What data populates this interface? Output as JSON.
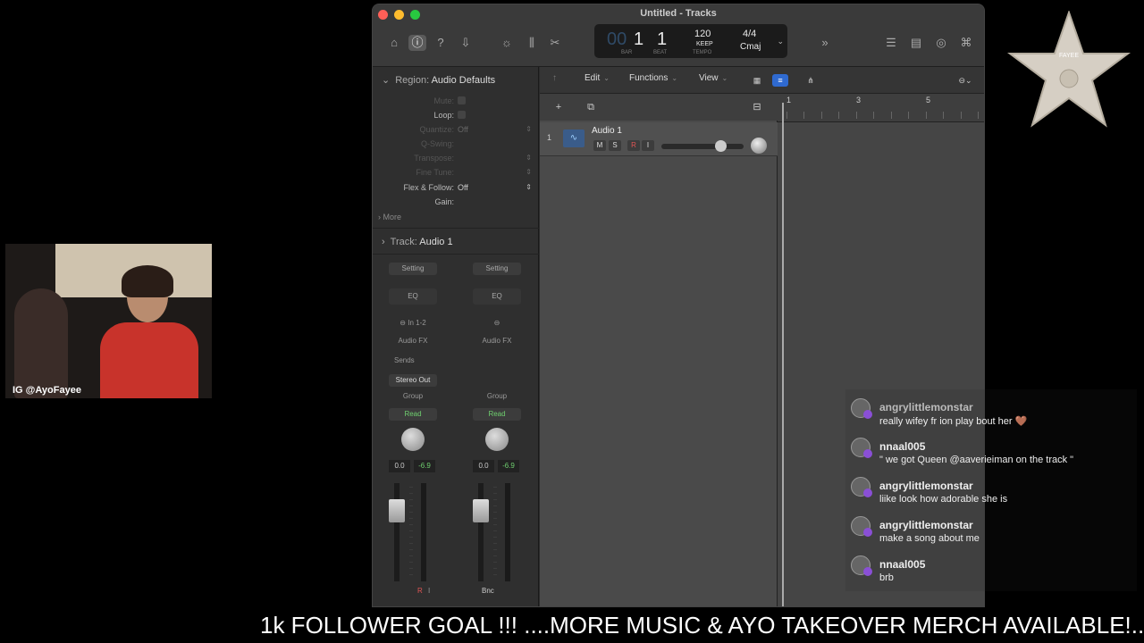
{
  "window": {
    "title": "Untitled - Tracks"
  },
  "lcd": {
    "bar": "1",
    "beat": "1",
    "bar_label": "BAR",
    "beat_label": "BEAT",
    "tempo": "120",
    "tempo_mode": "KEEP",
    "tempo_label": "TEMPO",
    "time_signature": "4/4",
    "key": "Cmaj"
  },
  "inspector": {
    "region_prefix": "Region:",
    "region_name": "Audio Defaults",
    "params": [
      {
        "label": "Mute:",
        "value": ""
      },
      {
        "label": "Loop:",
        "value": ""
      },
      {
        "label": "Quantize:",
        "value": "Off"
      },
      {
        "label": "Q-Swing:",
        "value": ""
      },
      {
        "label": "Transpose:",
        "value": ""
      },
      {
        "label": "Fine Tune:",
        "value": ""
      },
      {
        "label": "Flex & Follow:",
        "value": "Off"
      },
      {
        "label": "Gain:",
        "value": ""
      }
    ],
    "more_label": "More",
    "track_prefix": "Track:",
    "track_name": "Audio 1"
  },
  "strips": [
    {
      "setting": "Setting",
      "eq": "EQ",
      "input": "In 1-2",
      "audio_fx": "Audio FX",
      "sends": "Sends",
      "output": "Stereo Out",
      "group": "Group",
      "automation": "Read",
      "volume": "0.0",
      "peak": "-6.9",
      "rec": "R",
      "inp": "I",
      "bottom": ""
    },
    {
      "setting": "Setting",
      "eq": "EQ",
      "input": "",
      "audio_fx": "Audio FX",
      "sends": "",
      "output": "",
      "group": "Group",
      "automation": "Read",
      "volume": "0.0",
      "peak": "-6.9",
      "rec": "",
      "inp": "",
      "bottom": "Bnc"
    }
  ],
  "tracks_area": {
    "menus": [
      "Edit",
      "Functions",
      "View"
    ],
    "track": {
      "number": "1",
      "name": "Audio 1",
      "mute": "M",
      "solo": "S",
      "record": "R",
      "input_monitor": "I"
    },
    "ruler": [
      "1",
      "3",
      "5"
    ]
  },
  "chat": [
    {
      "user": "angrylittlemonstar",
      "text": "really wifey fr ion play bout her 🤎"
    },
    {
      "user": "nnaal005",
      "text": "\" we got Queen @aaverieiman on the track \""
    },
    {
      "user": "angrylittlemonstar",
      "text": "liike look how adorable she is"
    },
    {
      "user": "angrylittlemonstar",
      "text": "make a song about me"
    },
    {
      "user": "nnaal005",
      "text": "brb"
    }
  ],
  "webcam": {
    "label": "IG @AyoFayee"
  },
  "star": {
    "label": "FAYEE"
  },
  "ticker": {
    "text": "1k FOLLOWER GOAL !!! ....MORE MUSIC & AYO TAKEOVER MERCH AVAILABLE!.."
  },
  "colors": {
    "accent": "#2f6ad0",
    "record": "#e05555",
    "read_green": "#6fcf6f",
    "badge": "#8a4fd6"
  }
}
